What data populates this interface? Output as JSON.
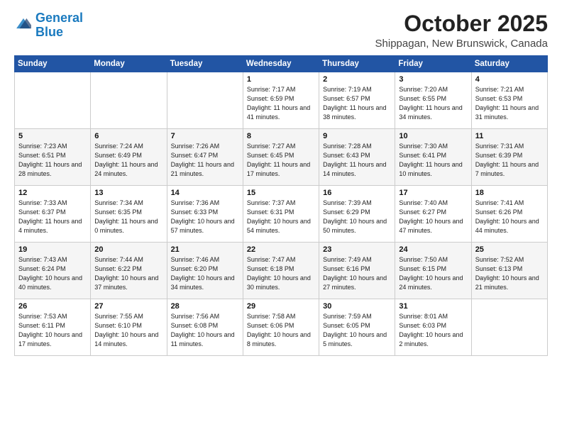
{
  "header": {
    "logo_line1": "General",
    "logo_line2": "Blue",
    "title": "October 2025",
    "subtitle": "Shippagan, New Brunswick, Canada"
  },
  "days_of_week": [
    "Sunday",
    "Monday",
    "Tuesday",
    "Wednesday",
    "Thursday",
    "Friday",
    "Saturday"
  ],
  "weeks": [
    [
      {
        "day": "",
        "sunrise": "",
        "sunset": "",
        "daylight": ""
      },
      {
        "day": "",
        "sunrise": "",
        "sunset": "",
        "daylight": ""
      },
      {
        "day": "",
        "sunrise": "",
        "sunset": "",
        "daylight": ""
      },
      {
        "day": "1",
        "sunrise": "Sunrise: 7:17 AM",
        "sunset": "Sunset: 6:59 PM",
        "daylight": "Daylight: 11 hours and 41 minutes."
      },
      {
        "day": "2",
        "sunrise": "Sunrise: 7:19 AM",
        "sunset": "Sunset: 6:57 PM",
        "daylight": "Daylight: 11 hours and 38 minutes."
      },
      {
        "day": "3",
        "sunrise": "Sunrise: 7:20 AM",
        "sunset": "Sunset: 6:55 PM",
        "daylight": "Daylight: 11 hours and 34 minutes."
      },
      {
        "day": "4",
        "sunrise": "Sunrise: 7:21 AM",
        "sunset": "Sunset: 6:53 PM",
        "daylight": "Daylight: 11 hours and 31 minutes."
      }
    ],
    [
      {
        "day": "5",
        "sunrise": "Sunrise: 7:23 AM",
        "sunset": "Sunset: 6:51 PM",
        "daylight": "Daylight: 11 hours and 28 minutes."
      },
      {
        "day": "6",
        "sunrise": "Sunrise: 7:24 AM",
        "sunset": "Sunset: 6:49 PM",
        "daylight": "Daylight: 11 hours and 24 minutes."
      },
      {
        "day": "7",
        "sunrise": "Sunrise: 7:26 AM",
        "sunset": "Sunset: 6:47 PM",
        "daylight": "Daylight: 11 hours and 21 minutes."
      },
      {
        "day": "8",
        "sunrise": "Sunrise: 7:27 AM",
        "sunset": "Sunset: 6:45 PM",
        "daylight": "Daylight: 11 hours and 17 minutes."
      },
      {
        "day": "9",
        "sunrise": "Sunrise: 7:28 AM",
        "sunset": "Sunset: 6:43 PM",
        "daylight": "Daylight: 11 hours and 14 minutes."
      },
      {
        "day": "10",
        "sunrise": "Sunrise: 7:30 AM",
        "sunset": "Sunset: 6:41 PM",
        "daylight": "Daylight: 11 hours and 10 minutes."
      },
      {
        "day": "11",
        "sunrise": "Sunrise: 7:31 AM",
        "sunset": "Sunset: 6:39 PM",
        "daylight": "Daylight: 11 hours and 7 minutes."
      }
    ],
    [
      {
        "day": "12",
        "sunrise": "Sunrise: 7:33 AM",
        "sunset": "Sunset: 6:37 PM",
        "daylight": "Daylight: 11 hours and 4 minutes."
      },
      {
        "day": "13",
        "sunrise": "Sunrise: 7:34 AM",
        "sunset": "Sunset: 6:35 PM",
        "daylight": "Daylight: 11 hours and 0 minutes."
      },
      {
        "day": "14",
        "sunrise": "Sunrise: 7:36 AM",
        "sunset": "Sunset: 6:33 PM",
        "daylight": "Daylight: 10 hours and 57 minutes."
      },
      {
        "day": "15",
        "sunrise": "Sunrise: 7:37 AM",
        "sunset": "Sunset: 6:31 PM",
        "daylight": "Daylight: 10 hours and 54 minutes."
      },
      {
        "day": "16",
        "sunrise": "Sunrise: 7:39 AM",
        "sunset": "Sunset: 6:29 PM",
        "daylight": "Daylight: 10 hours and 50 minutes."
      },
      {
        "day": "17",
        "sunrise": "Sunrise: 7:40 AM",
        "sunset": "Sunset: 6:27 PM",
        "daylight": "Daylight: 10 hours and 47 minutes."
      },
      {
        "day": "18",
        "sunrise": "Sunrise: 7:41 AM",
        "sunset": "Sunset: 6:26 PM",
        "daylight": "Daylight: 10 hours and 44 minutes."
      }
    ],
    [
      {
        "day": "19",
        "sunrise": "Sunrise: 7:43 AM",
        "sunset": "Sunset: 6:24 PM",
        "daylight": "Daylight: 10 hours and 40 minutes."
      },
      {
        "day": "20",
        "sunrise": "Sunrise: 7:44 AM",
        "sunset": "Sunset: 6:22 PM",
        "daylight": "Daylight: 10 hours and 37 minutes."
      },
      {
        "day": "21",
        "sunrise": "Sunrise: 7:46 AM",
        "sunset": "Sunset: 6:20 PM",
        "daylight": "Daylight: 10 hours and 34 minutes."
      },
      {
        "day": "22",
        "sunrise": "Sunrise: 7:47 AM",
        "sunset": "Sunset: 6:18 PM",
        "daylight": "Daylight: 10 hours and 30 minutes."
      },
      {
        "day": "23",
        "sunrise": "Sunrise: 7:49 AM",
        "sunset": "Sunset: 6:16 PM",
        "daylight": "Daylight: 10 hours and 27 minutes."
      },
      {
        "day": "24",
        "sunrise": "Sunrise: 7:50 AM",
        "sunset": "Sunset: 6:15 PM",
        "daylight": "Daylight: 10 hours and 24 minutes."
      },
      {
        "day": "25",
        "sunrise": "Sunrise: 7:52 AM",
        "sunset": "Sunset: 6:13 PM",
        "daylight": "Daylight: 10 hours and 21 minutes."
      }
    ],
    [
      {
        "day": "26",
        "sunrise": "Sunrise: 7:53 AM",
        "sunset": "Sunset: 6:11 PM",
        "daylight": "Daylight: 10 hours and 17 minutes."
      },
      {
        "day": "27",
        "sunrise": "Sunrise: 7:55 AM",
        "sunset": "Sunset: 6:10 PM",
        "daylight": "Daylight: 10 hours and 14 minutes."
      },
      {
        "day": "28",
        "sunrise": "Sunrise: 7:56 AM",
        "sunset": "Sunset: 6:08 PM",
        "daylight": "Daylight: 10 hours and 11 minutes."
      },
      {
        "day": "29",
        "sunrise": "Sunrise: 7:58 AM",
        "sunset": "Sunset: 6:06 PM",
        "daylight": "Daylight: 10 hours and 8 minutes."
      },
      {
        "day": "30",
        "sunrise": "Sunrise: 7:59 AM",
        "sunset": "Sunset: 6:05 PM",
        "daylight": "Daylight: 10 hours and 5 minutes."
      },
      {
        "day": "31",
        "sunrise": "Sunrise: 8:01 AM",
        "sunset": "Sunset: 6:03 PM",
        "daylight": "Daylight: 10 hours and 2 minutes."
      },
      {
        "day": "",
        "sunrise": "",
        "sunset": "",
        "daylight": ""
      }
    ]
  ]
}
